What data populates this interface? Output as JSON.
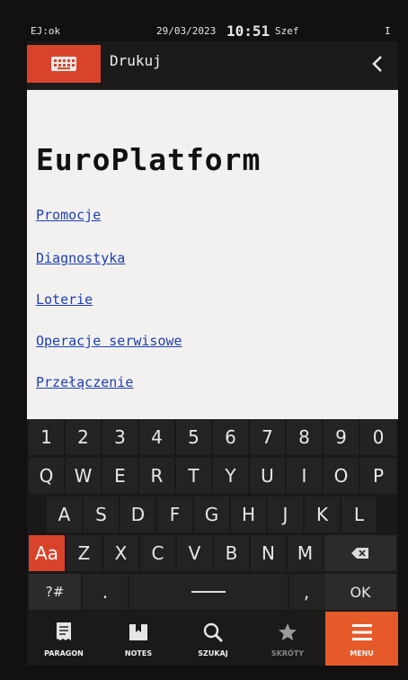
{
  "status": {
    "left": "EJ:ok",
    "date": "29/03/2023",
    "time": "10:51",
    "user": "Szef",
    "right": "I"
  },
  "header": {
    "title": "Drukuj",
    "back_icon": "chevron-left-icon",
    "keyboard_icon": "keyboard-icon"
  },
  "content": {
    "brand": "EuroPlatform",
    "links": [
      "Promocje",
      "Diagnostyka",
      "Loterie",
      "Operacje serwisowe",
      "Przełączenie"
    ]
  },
  "keyboard": {
    "numbers": [
      "1",
      "2",
      "3",
      "4",
      "5",
      "6",
      "7",
      "8",
      "9",
      "0"
    ],
    "row1": [
      "Q",
      "W",
      "E",
      "R",
      "T",
      "Y",
      "U",
      "I",
      "O",
      "P"
    ],
    "row2": [
      "A",
      "S",
      "D",
      "F",
      "G",
      "H",
      "J",
      "K",
      "L"
    ],
    "row3": [
      "Z",
      "X",
      "C",
      "V",
      "B",
      "N",
      "M"
    ],
    "shift_label": "Aa",
    "symbols_label": "?#",
    "period_label": ".",
    "comma_label": ",",
    "ok_label": "OK"
  },
  "bottom_nav": [
    {
      "label": "PARAGON",
      "icon": "receipt-icon"
    },
    {
      "label": "NOTES",
      "icon": "bookmark-icon"
    },
    {
      "label": "SZUKAJ",
      "icon": "search-icon"
    },
    {
      "label": "SKRÓTY",
      "icon": "star-icon"
    },
    {
      "label": "MENU",
      "icon": "menu-icon"
    }
  ],
  "colors": {
    "accent": "#d9432b",
    "menu": "#e65a2a",
    "link": "#1f3fb0"
  }
}
